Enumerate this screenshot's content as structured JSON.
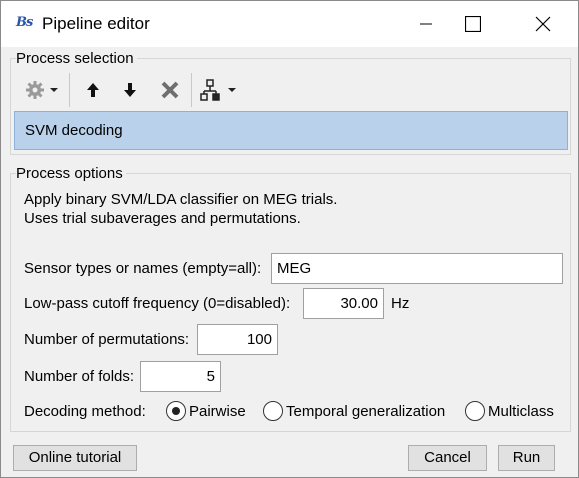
{
  "window": {
    "title": "Pipeline editor",
    "app_icon_text": "Bs"
  },
  "process_selection": {
    "section_label": "Process selection",
    "toolbar_icons": [
      "gear-icon",
      "arrow-up-icon",
      "arrow-down-icon",
      "delete-icon",
      "tree-icon"
    ],
    "selected_process": "SVM decoding"
  },
  "process_options": {
    "section_label": "Process options",
    "description_line1": "Apply binary SVM/LDA classifier on MEG trials.",
    "description_line2": "Uses trial subaverages and permutations.",
    "sensor_types": {
      "label": "Sensor types or names (empty=all):",
      "value": "MEG"
    },
    "lowpass": {
      "label": "Low-pass cutoff frequency (0=disabled):",
      "value": "30.00",
      "unit": "Hz"
    },
    "permutations": {
      "label": "Number of permutations:",
      "value": "100"
    },
    "folds": {
      "label": "Number of folds:",
      "value": "5"
    },
    "decoding_method": {
      "label": "Decoding method:",
      "options": [
        "Pairwise",
        "Temporal generalization",
        "Multiclass"
      ],
      "selected": "Pairwise"
    }
  },
  "buttons": {
    "tutorial": "Online tutorial",
    "cancel": "Cancel",
    "run": "Run"
  }
}
